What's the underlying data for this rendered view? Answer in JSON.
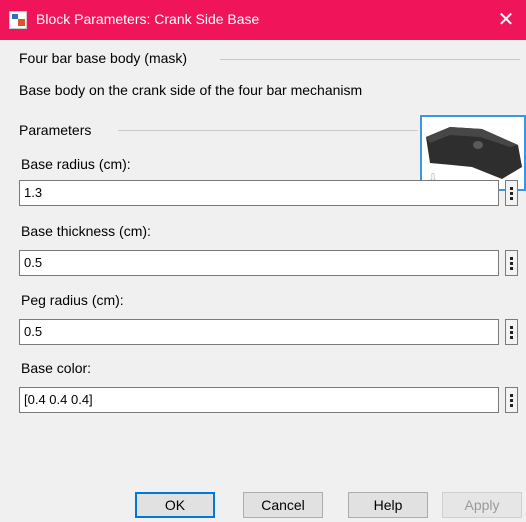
{
  "window": {
    "title": "Block Parameters: Crank Side Base",
    "close_symbol": "✕"
  },
  "mask": {
    "group_title": "Four bar base body (mask)",
    "description": "Base body on the crank side of the four bar mechanism"
  },
  "parameters": {
    "group_title": "Parameters",
    "fields": [
      {
        "label": "Base radius (cm):",
        "value": "1.3"
      },
      {
        "label": "Base thickness (cm):",
        "value": "0.5"
      },
      {
        "label": "Peg radius (cm):",
        "value": "0.5"
      },
      {
        "label": "Base color:",
        "value": "[0.4 0.4 0.4]"
      }
    ]
  },
  "buttons": {
    "ok": "OK",
    "cancel": "Cancel",
    "help": "Help",
    "apply": "Apply"
  },
  "colors": {
    "titlebar": "#f0145a",
    "preview_border": "#3a97e6"
  }
}
